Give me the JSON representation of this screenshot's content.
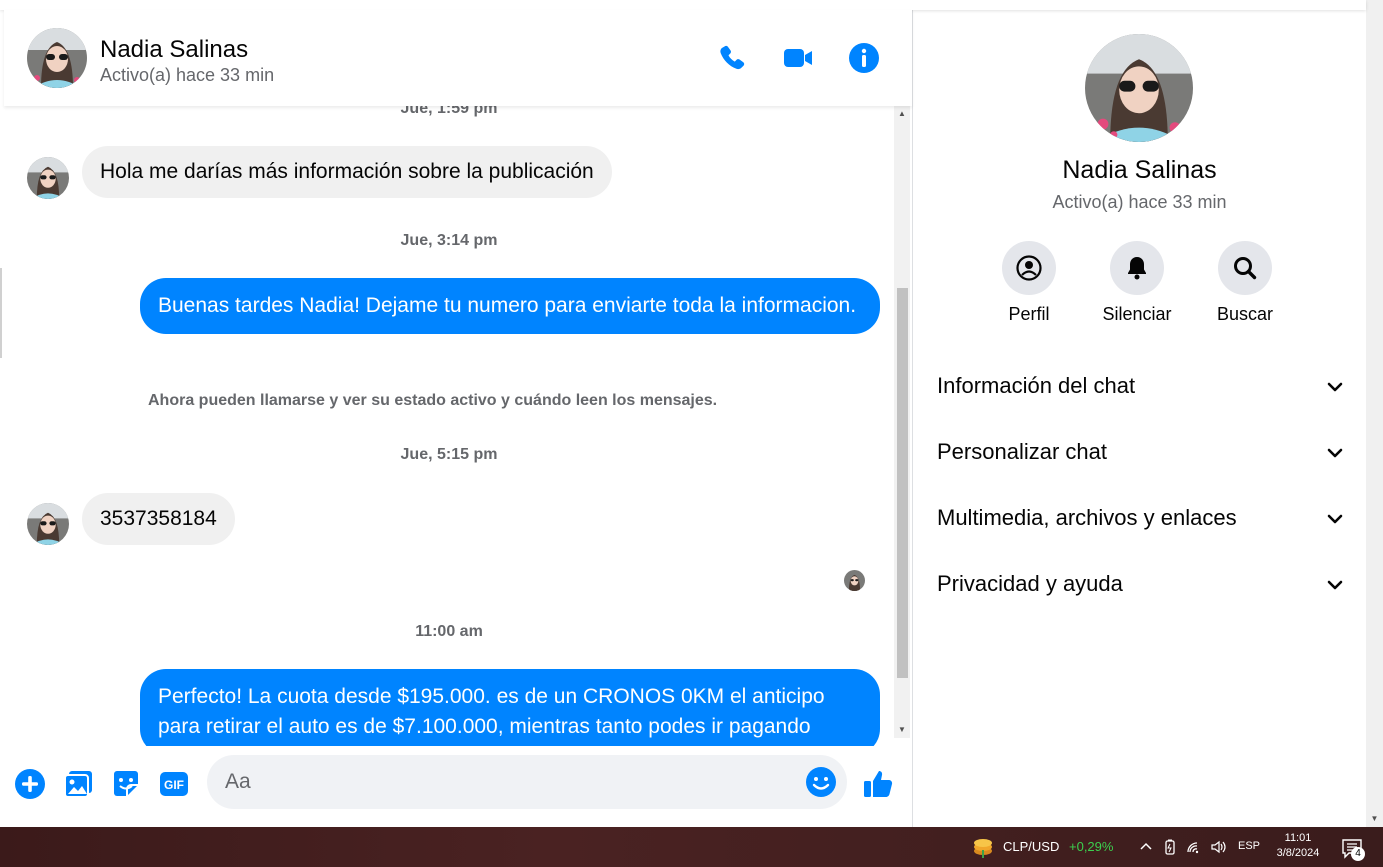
{
  "contact": {
    "name": "Nadia Salinas",
    "status": "Activo(a) hace 33 min"
  },
  "header": {
    "call_icon": "phone-icon",
    "video_icon": "video-camera-icon",
    "info_icon": "info-icon"
  },
  "messages": {
    "ts_1": "Jue, 1:59 pm",
    "msg_1": "Hola me darías más información sobre la publicación",
    "ts_2": "Jue, 3:14 pm",
    "msg_2": "Buenas tardes Nadia! Dejame tu numero para enviarte toda la informacion.",
    "notice": "Ahora pueden llamarse y ver su estado activo y cuándo leen los mensajes.",
    "ts_3": "Jue, 5:15 pm",
    "msg_3": "3537358184",
    "ts_4": "11:00 am",
    "msg_4": "Perfecto! La cuota desde $195.000. es de un CRONOS 0KM el anticipo para retirar el auto es de $7.100.000, mientras tanto podes ir pagando"
  },
  "composer": {
    "placeholder": "Aa",
    "icons": [
      "plus-icon",
      "photo-icon",
      "sticker-icon",
      "gif-icon",
      "emoji-icon",
      "thumbs-up-icon"
    ]
  },
  "info_panel": {
    "actions": {
      "profile": "Perfil",
      "mute": "Silenciar",
      "search": "Buscar"
    },
    "sections": {
      "chat_info": "Información del chat",
      "customize": "Personalizar chat",
      "media": "Multimedia, archivos y enlaces",
      "privacy": "Privacidad y ayuda"
    }
  },
  "taskbar": {
    "currency_pair": "CLP/USD",
    "currency_change": "+0,29%",
    "language": "ESP",
    "time": "11:01",
    "date": "3/8/2024",
    "notification_count": "4"
  },
  "colors": {
    "accent": "#0084ff",
    "bubble_in": "#f0f0f0",
    "muted_text": "#65676b",
    "change_positive": "#3ccf4e"
  }
}
